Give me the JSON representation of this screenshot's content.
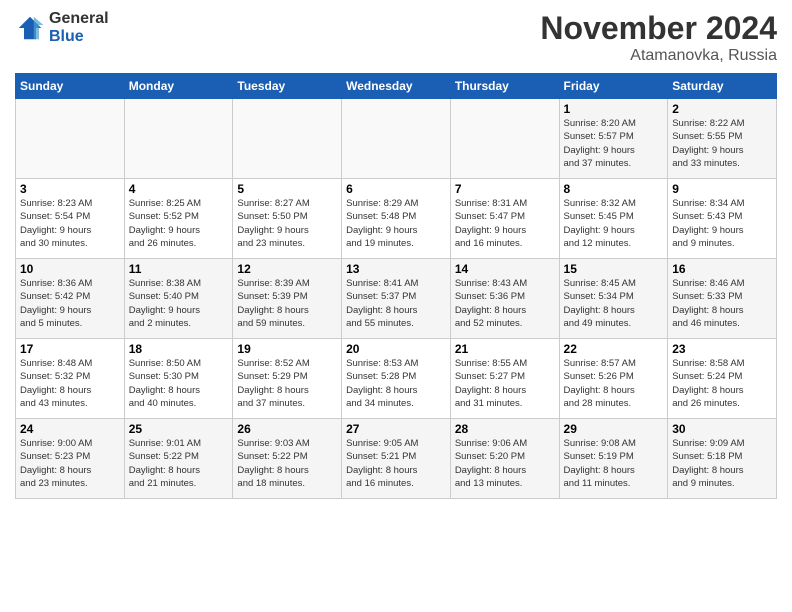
{
  "header": {
    "logo_line1": "General",
    "logo_line2": "Blue",
    "month": "November 2024",
    "location": "Atamanovka, Russia"
  },
  "days_of_week": [
    "Sunday",
    "Monday",
    "Tuesday",
    "Wednesday",
    "Thursday",
    "Friday",
    "Saturday"
  ],
  "weeks": [
    [
      {
        "day": "",
        "info": ""
      },
      {
        "day": "",
        "info": ""
      },
      {
        "day": "",
        "info": ""
      },
      {
        "day": "",
        "info": ""
      },
      {
        "day": "",
        "info": ""
      },
      {
        "day": "1",
        "info": "Sunrise: 8:20 AM\nSunset: 5:57 PM\nDaylight: 9 hours\nand 37 minutes."
      },
      {
        "day": "2",
        "info": "Sunrise: 8:22 AM\nSunset: 5:55 PM\nDaylight: 9 hours\nand 33 minutes."
      }
    ],
    [
      {
        "day": "3",
        "info": "Sunrise: 8:23 AM\nSunset: 5:54 PM\nDaylight: 9 hours\nand 30 minutes."
      },
      {
        "day": "4",
        "info": "Sunrise: 8:25 AM\nSunset: 5:52 PM\nDaylight: 9 hours\nand 26 minutes."
      },
      {
        "day": "5",
        "info": "Sunrise: 8:27 AM\nSunset: 5:50 PM\nDaylight: 9 hours\nand 23 minutes."
      },
      {
        "day": "6",
        "info": "Sunrise: 8:29 AM\nSunset: 5:48 PM\nDaylight: 9 hours\nand 19 minutes."
      },
      {
        "day": "7",
        "info": "Sunrise: 8:31 AM\nSunset: 5:47 PM\nDaylight: 9 hours\nand 16 minutes."
      },
      {
        "day": "8",
        "info": "Sunrise: 8:32 AM\nSunset: 5:45 PM\nDaylight: 9 hours\nand 12 minutes."
      },
      {
        "day": "9",
        "info": "Sunrise: 8:34 AM\nSunset: 5:43 PM\nDaylight: 9 hours\nand 9 minutes."
      }
    ],
    [
      {
        "day": "10",
        "info": "Sunrise: 8:36 AM\nSunset: 5:42 PM\nDaylight: 9 hours\nand 5 minutes."
      },
      {
        "day": "11",
        "info": "Sunrise: 8:38 AM\nSunset: 5:40 PM\nDaylight: 9 hours\nand 2 minutes."
      },
      {
        "day": "12",
        "info": "Sunrise: 8:39 AM\nSunset: 5:39 PM\nDaylight: 8 hours\nand 59 minutes."
      },
      {
        "day": "13",
        "info": "Sunrise: 8:41 AM\nSunset: 5:37 PM\nDaylight: 8 hours\nand 55 minutes."
      },
      {
        "day": "14",
        "info": "Sunrise: 8:43 AM\nSunset: 5:36 PM\nDaylight: 8 hours\nand 52 minutes."
      },
      {
        "day": "15",
        "info": "Sunrise: 8:45 AM\nSunset: 5:34 PM\nDaylight: 8 hours\nand 49 minutes."
      },
      {
        "day": "16",
        "info": "Sunrise: 8:46 AM\nSunset: 5:33 PM\nDaylight: 8 hours\nand 46 minutes."
      }
    ],
    [
      {
        "day": "17",
        "info": "Sunrise: 8:48 AM\nSunset: 5:32 PM\nDaylight: 8 hours\nand 43 minutes."
      },
      {
        "day": "18",
        "info": "Sunrise: 8:50 AM\nSunset: 5:30 PM\nDaylight: 8 hours\nand 40 minutes."
      },
      {
        "day": "19",
        "info": "Sunrise: 8:52 AM\nSunset: 5:29 PM\nDaylight: 8 hours\nand 37 minutes."
      },
      {
        "day": "20",
        "info": "Sunrise: 8:53 AM\nSunset: 5:28 PM\nDaylight: 8 hours\nand 34 minutes."
      },
      {
        "day": "21",
        "info": "Sunrise: 8:55 AM\nSunset: 5:27 PM\nDaylight: 8 hours\nand 31 minutes."
      },
      {
        "day": "22",
        "info": "Sunrise: 8:57 AM\nSunset: 5:26 PM\nDaylight: 8 hours\nand 28 minutes."
      },
      {
        "day": "23",
        "info": "Sunrise: 8:58 AM\nSunset: 5:24 PM\nDaylight: 8 hours\nand 26 minutes."
      }
    ],
    [
      {
        "day": "24",
        "info": "Sunrise: 9:00 AM\nSunset: 5:23 PM\nDaylight: 8 hours\nand 23 minutes."
      },
      {
        "day": "25",
        "info": "Sunrise: 9:01 AM\nSunset: 5:22 PM\nDaylight: 8 hours\nand 21 minutes."
      },
      {
        "day": "26",
        "info": "Sunrise: 9:03 AM\nSunset: 5:22 PM\nDaylight: 8 hours\nand 18 minutes."
      },
      {
        "day": "27",
        "info": "Sunrise: 9:05 AM\nSunset: 5:21 PM\nDaylight: 8 hours\nand 16 minutes."
      },
      {
        "day": "28",
        "info": "Sunrise: 9:06 AM\nSunset: 5:20 PM\nDaylight: 8 hours\nand 13 minutes."
      },
      {
        "day": "29",
        "info": "Sunrise: 9:08 AM\nSunset: 5:19 PM\nDaylight: 8 hours\nand 11 minutes."
      },
      {
        "day": "30",
        "info": "Sunrise: 9:09 AM\nSunset: 5:18 PM\nDaylight: 8 hours\nand 9 minutes."
      }
    ]
  ]
}
